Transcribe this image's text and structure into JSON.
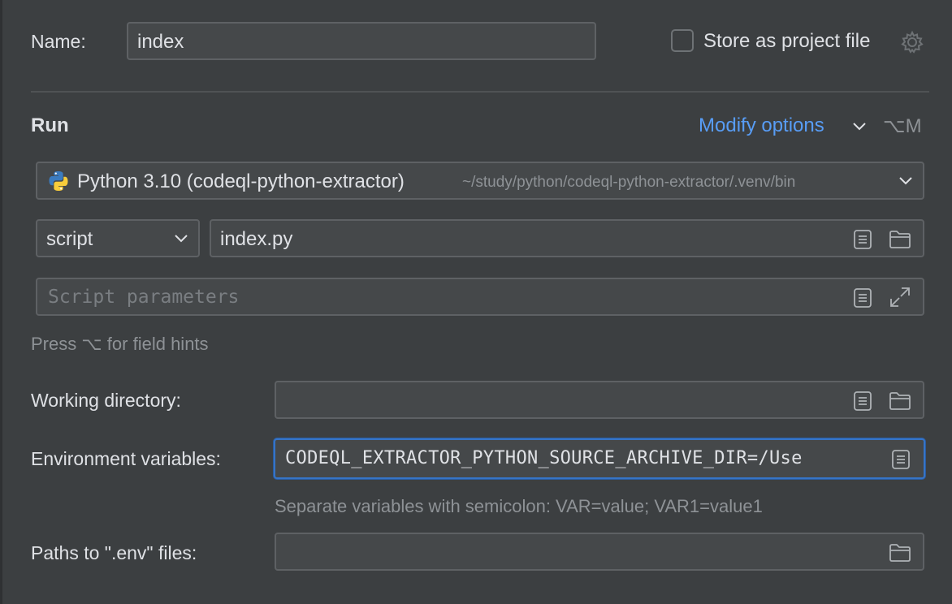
{
  "name_row": {
    "label": "Name:",
    "value": "index",
    "store_label": "Store as project file",
    "store_checked": false
  },
  "run_section": {
    "title": "Run",
    "modify_options": "Modify options",
    "shortcut": "⌥M"
  },
  "interpreter": {
    "name": "Python 3.10 (codeql-python-extractor)",
    "path": "~/study/python/codeql-python-extractor/.venv/bin"
  },
  "script_row": {
    "type": "script",
    "value": "index.py"
  },
  "parameters": {
    "placeholder": "Script parameters"
  },
  "hint": "Press ⌥ for field hints",
  "working_dir": {
    "label": "Working directory:",
    "value": ""
  },
  "env_vars": {
    "label": "Environment variables:",
    "value": "CODEQL_EXTRACTOR_PYTHON_SOURCE_ARCHIVE_DIR=/Use",
    "hint": "Separate variables with semicolon: VAR=value; VAR1=value1"
  },
  "env_files": {
    "label": "Paths to \".env\" files:",
    "value": ""
  },
  "colors": {
    "background": "#3c3f41",
    "field": "#45484a",
    "accent": "#589df6",
    "focus": "#3574c8"
  }
}
